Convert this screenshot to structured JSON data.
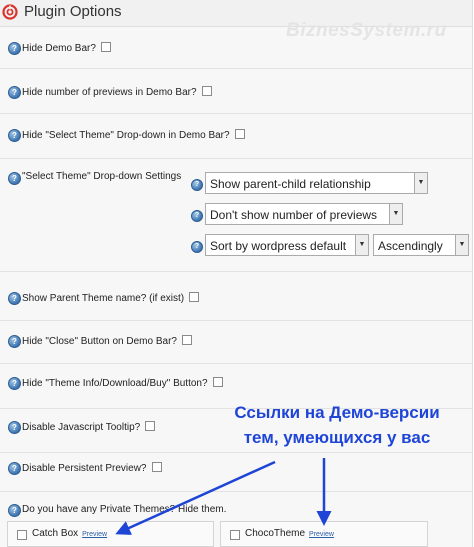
{
  "header": {
    "title": "Plugin Options",
    "logo_icon": "swirl-logo-icon",
    "logo_color": "#d9342b"
  },
  "watermark": "BiznesSystem.ru",
  "options": [
    {
      "label": "Hide Demo Bar?"
    },
    {
      "label": "Hide number of previews in Demo Bar?"
    },
    {
      "label": "Hide \"Select Theme\" Drop-down in Demo Bar?"
    },
    {
      "label": "\"Select Theme\" Drop-down Settings"
    },
    {
      "label": "Show Parent Theme name? (if exist)"
    },
    {
      "label": "Hide \"Close\" Button on Demo Bar?"
    },
    {
      "label": "Hide \"Theme Info/Download/Buy\" Button?"
    },
    {
      "label": "Disable Javascript Tooltip?"
    },
    {
      "label": "Disable Persistent Preview?"
    },
    {
      "label": "Do you have any Private Themes? Hide them."
    }
  ],
  "dropdowns": {
    "relationship": "Show parent-child relationship",
    "previews": "Don't show number of previews",
    "sort_by": "Sort by wordpress default",
    "order": "Ascendingly"
  },
  "help_icon_glyph": "?",
  "arrow_glyph": "▼",
  "themes": [
    {
      "name": "Catch Box",
      "preview": "Preview"
    },
    {
      "name": "ChocoTheme",
      "preview": "Preview"
    }
  ],
  "annotation": {
    "line1": "Ссылки на Демо-версии",
    "line2": "тем, умеющихся у вас",
    "color": "#1f45d6"
  },
  "colors": {
    "help_icon": "#3c74b0",
    "link": "#2a5ea8"
  }
}
